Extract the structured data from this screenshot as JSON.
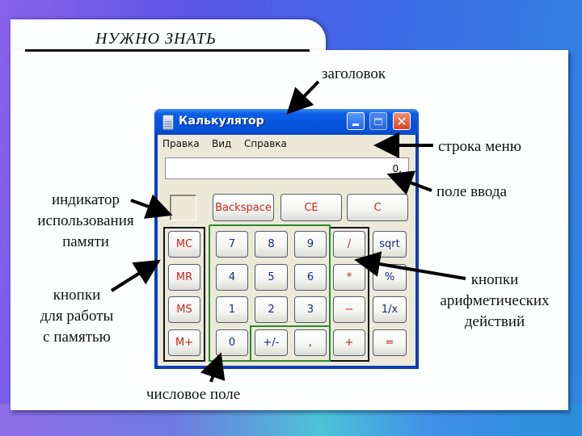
{
  "slide": {
    "heading": "НУЖНО ЗНАТЬ",
    "annotations": {
      "title": "заголовок",
      "menu_bar": "строка меню",
      "input_field": "поле ввода",
      "memory_indicator": [
        "индикатор",
        "использования",
        "памяти"
      ],
      "memory_buttons": [
        "кнопки",
        "для работы",
        "с памятью"
      ],
      "arithmetic_buttons": [
        "кнопки",
        "арифметических",
        "действий"
      ],
      "number_field": "числовое поле"
    }
  },
  "window": {
    "title": "Калькулятор",
    "icon": "calculator-icon",
    "controls": {
      "minimize": "minimize-icon",
      "maximize": "maximize-icon",
      "close": "✕"
    },
    "menu": [
      "Правка",
      "Вид",
      "Справка"
    ],
    "display_value": "0,",
    "top_buttons": [
      "Backspace",
      "CE",
      "C"
    ],
    "memory_buttons": [
      "MC",
      "MR",
      "MS",
      "M+"
    ],
    "keypad": [
      [
        "7",
        "8",
        "9",
        "/",
        "sqrt"
      ],
      [
        "4",
        "5",
        "6",
        "*",
        "%"
      ],
      [
        "1",
        "2",
        "3",
        "−",
        "1/x"
      ],
      [
        "0",
        "+/-",
        ",",
        "+",
        "="
      ]
    ]
  },
  "colors": {
    "highlight_black": "#111111",
    "highlight_green": "#2c8a2c",
    "function_text": "#c8241c",
    "digit_text": "#1a2a8a"
  }
}
